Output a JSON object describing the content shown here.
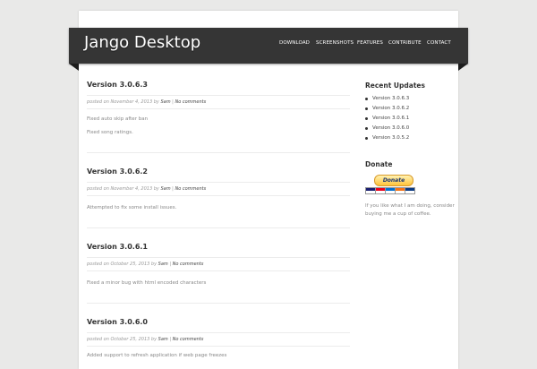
{
  "site": {
    "title": "Jango Desktop"
  },
  "nav": [
    "DOWNLOAD",
    "SCREENSHOTS",
    "FEATURES",
    "CONTRIBUTE",
    "CONTACT"
  ],
  "posts": [
    {
      "title": "Version 3.0.6.3",
      "posted": "posted on November 4, 2013 by",
      "author": "Sam",
      "sep": "|",
      "comments": "No comments",
      "body": [
        "Fixed auto skip after ban",
        "Fixed song ratings."
      ]
    },
    {
      "title": "Version 3.0.6.2",
      "posted": "posted on November 4, 2013 by",
      "author": "Sam",
      "sep": "|",
      "comments": "No comments",
      "body": [
        "Attempted to fix some install issues."
      ]
    },
    {
      "title": "Version 3.0.6.1",
      "posted": "posted on October 25, 2013 by",
      "author": "Sam",
      "sep": "|",
      "comments": "No comments",
      "body": [
        "Fixed a minor bug with html encoded characters"
      ]
    },
    {
      "title": "Version 3.0.6.0",
      "posted": "posted on October 25, 2013 by",
      "author": "Sam",
      "sep": "|",
      "comments": "No comments",
      "body": [
        "Added support to refresh application if web page freezes"
      ]
    }
  ],
  "sidebar": {
    "recent_title": "Recent Updates",
    "recent": [
      "Version 3.0.6.3",
      "Version 3.0.6.2",
      "Version 3.0.6.1",
      "Version 3.0.6.0",
      "Version 3.0.5.2"
    ],
    "donate_title": "Donate",
    "donate_button": "Donate",
    "card_colors": [
      "#1a1f71",
      "#eb001b",
      "#016fd0",
      "#f47216",
      "#0a3a82"
    ],
    "donate_text": [
      "If you like what I am doing, consider",
      "buying me a cup of coffee."
    ]
  }
}
